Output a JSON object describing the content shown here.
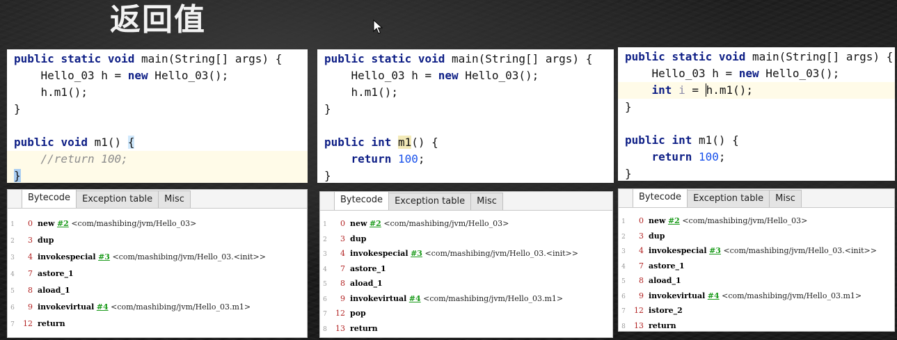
{
  "slide": {
    "title": "返回值"
  },
  "panels": [
    {
      "code": {
        "main_sig": "main(String[] args) {",
        "new_line": "Hello_03 h = ",
        "ctor": " Hello_03();",
        "call": "h.m1();",
        "close": "}",
        "m1_type": "void",
        "m1_name": "m1()",
        "m1_open": "{",
        "m1_body": "//return 100;",
        "m1_close": "}"
      },
      "bytecode": {
        "tabs": [
          "Bytecode",
          "Exception table",
          "Misc"
        ],
        "rows": [
          {
            "ln": "1",
            "off": "0",
            "op": "new",
            "ref": "#2",
            "arg": "<com/mashibing/jvm/Hello_03>"
          },
          {
            "ln": "2",
            "off": "3",
            "op": "dup",
            "ref": "",
            "arg": ""
          },
          {
            "ln": "3",
            "off": "4",
            "op": "invokespecial",
            "ref": "#3",
            "arg": "<com/mashibing/jvm/Hello_03.<init>>"
          },
          {
            "ln": "4",
            "off": "7",
            "op": "astore_1",
            "ref": "",
            "arg": ""
          },
          {
            "ln": "5",
            "off": "8",
            "op": "aload_1",
            "ref": "",
            "arg": ""
          },
          {
            "ln": "6",
            "off": "9",
            "op": "invokevirtual",
            "ref": "#4",
            "arg": "<com/mashibing/jvm/Hello_03.m1>"
          },
          {
            "ln": "7",
            "off": "12",
            "op": "return",
            "ref": "",
            "arg": ""
          }
        ]
      }
    },
    {
      "code": {
        "main_sig": "main(String[] args) {",
        "new_line": "Hello_03 h = ",
        "ctor": " Hello_03();",
        "call": "h.m1();",
        "close": "}",
        "m1_type": "int",
        "m1_name": "m1",
        "m1_paren": "() {",
        "ret_kw": "return",
        "ret_val": "100",
        "semi": ";",
        "m1_close": "}"
      },
      "bytecode": {
        "tabs": [
          "Bytecode",
          "Exception table",
          "Misc"
        ],
        "rows": [
          {
            "ln": "1",
            "off": "0",
            "op": "new",
            "ref": "#2",
            "arg": "<com/mashibing/jvm/Hello_03>"
          },
          {
            "ln": "2",
            "off": "3",
            "op": "dup",
            "ref": "",
            "arg": ""
          },
          {
            "ln": "3",
            "off": "4",
            "op": "invokespecial",
            "ref": "#3",
            "arg": "<com/mashibing/jvm/Hello_03.<init>>"
          },
          {
            "ln": "4",
            "off": "7",
            "op": "astore_1",
            "ref": "",
            "arg": ""
          },
          {
            "ln": "5",
            "off": "8",
            "op": "aload_1",
            "ref": "",
            "arg": ""
          },
          {
            "ln": "6",
            "off": "9",
            "op": "invokevirtual",
            "ref": "#4",
            "arg": "<com/mashibing/jvm/Hello_03.m1>"
          },
          {
            "ln": "7",
            "off": "12",
            "op": "pop",
            "ref": "",
            "arg": ""
          },
          {
            "ln": "8",
            "off": "13",
            "op": "return",
            "ref": "",
            "arg": ""
          }
        ]
      }
    },
    {
      "code": {
        "main_sig": "main(String[] args) {",
        "new_line": "Hello_03 h = ",
        "ctor": " Hello_03();",
        "int_kw": "int",
        "var_i": "i",
        "eq": " = ",
        "call_h": "h",
        "call_rest": ".m1();",
        "close": "}",
        "m1_type": "int",
        "m1_name": "m1() {",
        "ret_kw": "return",
        "ret_val": "100",
        "semi": ";",
        "m1_close": "}"
      },
      "bytecode": {
        "tabs": [
          "Bytecode",
          "Exception table",
          "Misc"
        ],
        "rows": [
          {
            "ln": "1",
            "off": "0",
            "op": "new",
            "ref": "#2",
            "arg": "<com/mashibing/jvm/Hello_03>"
          },
          {
            "ln": "2",
            "off": "3",
            "op": "dup",
            "ref": "",
            "arg": ""
          },
          {
            "ln": "3",
            "off": "4",
            "op": "invokespecial",
            "ref": "#3",
            "arg": "<com/mashibing/jvm/Hello_03.<init>>"
          },
          {
            "ln": "4",
            "off": "7",
            "op": "astore_1",
            "ref": "",
            "arg": ""
          },
          {
            "ln": "5",
            "off": "8",
            "op": "aload_1",
            "ref": "",
            "arg": ""
          },
          {
            "ln": "6",
            "off": "9",
            "op": "invokevirtual",
            "ref": "#4",
            "arg": "<com/mashibing/jvm/Hello_03.m1>"
          },
          {
            "ln": "7",
            "off": "12",
            "op": "istore_2",
            "ref": "",
            "arg": ""
          },
          {
            "ln": "8",
            "off": "13",
            "op": "return",
            "ref": "",
            "arg": ""
          }
        ]
      }
    }
  ],
  "keywords": {
    "public": "public",
    "static": "static",
    "void": "void",
    "new": "new"
  }
}
